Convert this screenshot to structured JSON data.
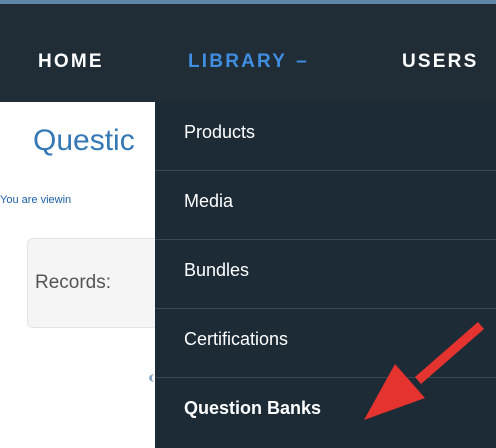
{
  "navbar": {
    "items": [
      {
        "label": "HOME"
      },
      {
        "label": "LIBRARY",
        "toggle": "–"
      },
      {
        "label": "USERS"
      }
    ]
  },
  "main": {
    "title": "Questic",
    "viewing_text": "You are viewin",
    "records_label": "Records:"
  },
  "dropdown": {
    "items": [
      {
        "label": "Products"
      },
      {
        "label": "Media"
      },
      {
        "label": "Bundles"
      },
      {
        "label": "Certifications"
      },
      {
        "label": "Question Banks"
      }
    ]
  },
  "annotation": {
    "arrow_icon": "red-pointer-arrow",
    "color": "#e5332f"
  },
  "colors": {
    "navbar_bg": "#202d37",
    "dropdown_bg": "#1c2b35",
    "active_nav": "#3f8ee0",
    "title": "#3578b6"
  }
}
